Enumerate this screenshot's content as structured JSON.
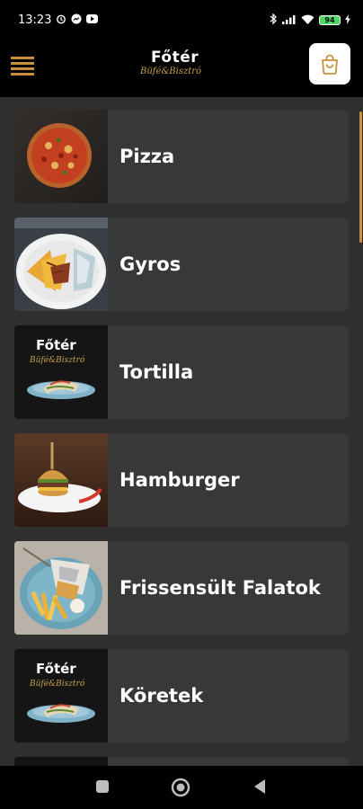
{
  "status_bar": {
    "time": "13:23",
    "battery": "94",
    "icons": [
      "alarm-icon",
      "messenger-icon",
      "youtube-icon",
      "bluetooth-icon",
      "signal-icon",
      "wifi-icon",
      "battery-icon",
      "charging-icon"
    ]
  },
  "app_bar": {
    "logo_title": "Főtér",
    "logo_subtitle": "Büfé&Bisztró",
    "menu_icon": "hamburger-menu-icon",
    "cart_icon": "shopping-bag-icon"
  },
  "colors": {
    "accent": "#c9903c",
    "background": "#2f2f2f",
    "card": "#383838",
    "bar": "#000000"
  },
  "categories": [
    {
      "label": "Pizza",
      "image": "pizza-photo"
    },
    {
      "label": "Gyros",
      "image": "gyros-photo"
    },
    {
      "label": "Tortilla",
      "image": "tortilla-photo"
    },
    {
      "label": "Hamburger",
      "image": "hamburger-photo"
    },
    {
      "label": "Frissensült Falatok",
      "image": "fried-snacks-photo"
    },
    {
      "label": "Köretek",
      "image": "sides-photo"
    }
  ],
  "nav_bar": {
    "icons": [
      "recent-apps-icon",
      "home-icon",
      "back-icon"
    ]
  }
}
